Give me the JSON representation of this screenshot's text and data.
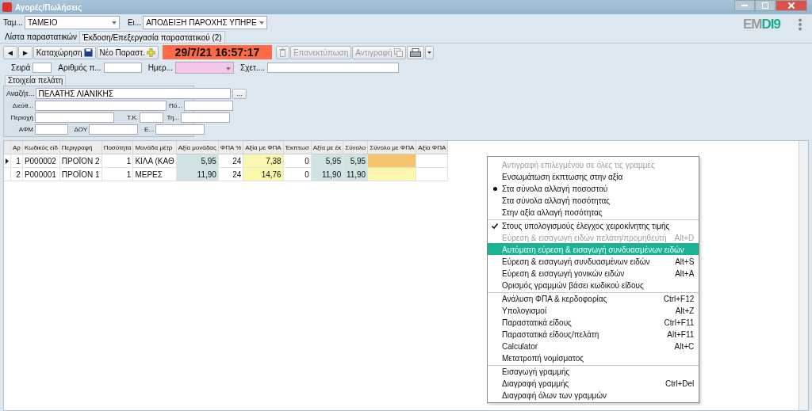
{
  "window": {
    "title": "Αγορές/Πωλήσεις"
  },
  "header": {
    "register_label": "Ταμ...",
    "register_value": "ΤΑΜΕΙΟ",
    "doctype_label": "Ει...",
    "doctype_value": "ΑΠΟΔΕΙΞΗ ΠΑΡΟΧΗΣ ΥΠΗΡΕ",
    "logo": [
      "EM",
      "DI9"
    ]
  },
  "tabs": [
    {
      "label": "Λίστα παραστατικών",
      "selected": false
    },
    {
      "label": "Έκδοση/Επεξεργασία παραστατικού (2)",
      "selected": true
    }
  ],
  "toolbar": {
    "prev": "◄",
    "next": "►",
    "save": "Καταχώρηση",
    "new": "Νέο Παραστ.",
    "datetime": "29/7/21 16:57:17",
    "reprint": "Επανεκτύπωση",
    "reprint_disabled": true,
    "copy": "Αντιγραφή",
    "copy_disabled": true,
    "delete_disabled": true
  },
  "doc_fields": [
    {
      "label": "Σειρά",
      "kind": "small"
    },
    {
      "label": "Αριθμός π...",
      "kind": "medium"
    },
    {
      "label": "Ημερ...",
      "kind": "date"
    },
    {
      "label": "Σχετ....",
      "kind": "wide"
    }
  ],
  "customer": {
    "tab": "Στοιχεία πελάτη",
    "search_label": "Αναζήτ...",
    "search_value": "ΠΕΛΑΤΗΣ ΛΙΑΝΙΚΗΣ",
    "browse": "...",
    "address": "Διεύθ...",
    "city": "Πό...",
    "area": "Περιοχή",
    "zip": "Τ.Κ.",
    "phone": "Τη...",
    "vat_no": "ΑΦΜ",
    "tax_office": "ΔΟΥ",
    "email": "Ε..."
  },
  "table": {
    "columns": [
      {
        "label": "Αρ",
        "kind": "plain"
      },
      {
        "label": "Κωδικός είδ",
        "kind": "plain"
      },
      {
        "label": "Περιγραφή",
        "kind": "plain"
      },
      {
        "label": "Ποσότητα",
        "kind": "num"
      },
      {
        "label": "Μονάδα μέτρ",
        "kind": "plain"
      },
      {
        "label": "Αξία μονάδας",
        "kind": "calc"
      },
      {
        "label": "ΦΠΑ %",
        "kind": "num"
      },
      {
        "label": "Αξία με ΦΠΑ",
        "kind": "vat"
      },
      {
        "label": "Έκπτωσ",
        "kind": "num"
      },
      {
        "label": "Αξία με έκ",
        "kind": "calc"
      },
      {
        "label": "Σύνολο",
        "kind": "calc"
      },
      {
        "label": "Σύνολο με ΦΠΑ",
        "kind": "vat"
      },
      {
        "label": "Αξία ΦΠΑ",
        "kind": "plain"
      }
    ],
    "rows": [
      {
        "selected": true,
        "cells": [
          "1",
          "P000002",
          "ΠΡΟΪΟΝ 2",
          "1",
          "ΚΙΛΑ (ΚΑΘ",
          "5,95",
          "24",
          "7,38",
          "0",
          "5,95",
          "5,95"
        ]
      },
      {
        "selected": false,
        "cells": [
          "2",
          "P000001",
          "ΠΡΟΪΟΝ 1",
          "1",
          "ΜΕΡΕΣ",
          "11,90",
          "24",
          "14,76",
          "0",
          "11,90",
          "11,90"
        ]
      }
    ]
  },
  "context_menu": [
    {
      "label": "Αντιγραφή επιλεγμένου σε όλες τις γραμμές",
      "disabled": true,
      "bullet": false,
      "checked": false,
      "highlighted": false,
      "separator_before": false
    },
    {
      "label": "Ενσωμάτωση έκπτωσης στην αξία",
      "disabled": false,
      "bullet": false,
      "checked": false,
      "highlighted": false,
      "separator_before": false
    },
    {
      "label": "Στα σύνολα αλλαγή ποσοστού",
      "disabled": false,
      "bullet": true,
      "checked": false,
      "highlighted": false,
      "separator_before": false
    },
    {
      "label": "Στα σύνολα αλλαγή ποσότητας",
      "disabled": false,
      "bullet": false,
      "checked": false,
      "highlighted": false,
      "separator_before": false
    },
    {
      "label": "Στην αξία αλλαγή ποσότητας",
      "disabled": false,
      "bullet": false,
      "checked": false,
      "highlighted": false,
      "separator_before": false
    },
    {
      "label": "Στους υπολογισμούς έλεγχος χειροκίνητης τιμής",
      "disabled": false,
      "bullet": false,
      "checked": true,
      "highlighted": false,
      "separator_before": true
    },
    {
      "label": "Εύρεση & εισαγωγή ειδών πελάτη/προμηθευτή",
      "shortcut": "Alt+D",
      "disabled": true,
      "bullet": false,
      "checked": false,
      "highlighted": false,
      "separator_before": false
    },
    {
      "label": "Αυτόματη εύρεση & εισαγωγή συνδυασμένων ειδών",
      "disabled": false,
      "bullet": false,
      "checked": false,
      "highlighted": true,
      "separator_before": false
    },
    {
      "label": "Εύρεση & εισαγωγή συνδυασμένων ειδών",
      "shortcut": "Alt+S",
      "disabled": false,
      "bullet": false,
      "checked": false,
      "highlighted": false,
      "separator_before": false
    },
    {
      "label": "Εύρεση & εισαγωγή γονικών ειδών",
      "shortcut": "Alt+A",
      "disabled": false,
      "bullet": false,
      "checked": false,
      "highlighted": false,
      "separator_before": false
    },
    {
      "label": "Ορισμός γραμμών βάσει κωδικού είδους",
      "disabled": false,
      "bullet": false,
      "checked": false,
      "highlighted": false,
      "separator_before": false
    },
    {
      "label": "Ανάλυση ΦΠΑ & κερδοφορίας",
      "shortcut": "Ctrl+F12",
      "disabled": false,
      "bullet": false,
      "checked": false,
      "highlighted": false,
      "separator_before": true
    },
    {
      "label": "Υπολογισμοί",
      "shortcut": "Alt+Z",
      "disabled": false,
      "bullet": false,
      "checked": false,
      "highlighted": false,
      "separator_before": false
    },
    {
      "label": "Παραστατικά είδους",
      "shortcut": "Ctrl+F11",
      "disabled": false,
      "bullet": false,
      "checked": false,
      "highlighted": false,
      "separator_before": false
    },
    {
      "label": "Παραστατικά είδους/πελάτη",
      "shortcut": "Alt+F11",
      "disabled": false,
      "bullet": false,
      "checked": false,
      "highlighted": false,
      "separator_before": false
    },
    {
      "label": "Calculator",
      "shortcut": "Alt+C",
      "disabled": false,
      "bullet": false,
      "checked": false,
      "highlighted": false,
      "separator_before": false
    },
    {
      "label": "Μετατροπή νομίσματος",
      "disabled": false,
      "bullet": false,
      "checked": false,
      "highlighted": false,
      "separator_before": false
    },
    {
      "label": "Εισαγωγή γραμμής",
      "disabled": false,
      "bullet": false,
      "checked": false,
      "highlighted": false,
      "separator_before": true
    },
    {
      "label": "Διαγραφή γραμμής",
      "shortcut": "Ctrl+Del",
      "disabled": false,
      "bullet": false,
      "checked": false,
      "highlighted": false,
      "separator_before": false
    },
    {
      "label": "Διαγραφή όλων των γραμμών",
      "disabled": false,
      "bullet": false,
      "checked": false,
      "highlighted": false,
      "separator_before": false
    }
  ]
}
